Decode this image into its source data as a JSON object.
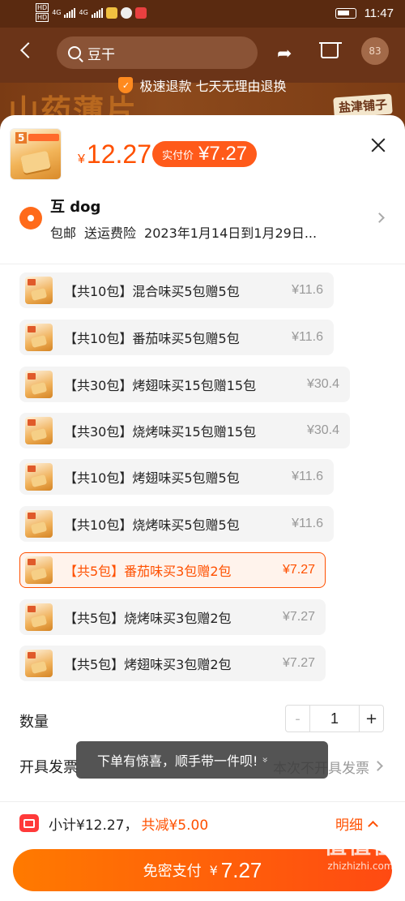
{
  "status_bar": {
    "network_1": "4G",
    "network_2": "4G",
    "hd_label": "HD",
    "time": "11:47"
  },
  "nav": {
    "search_text": "豆干",
    "cart_badge": "83"
  },
  "banner": {
    "refund_text": "极速退款 七天无理由退换",
    "bg_title": "山药薄片",
    "bg_brand": "盐津铺子"
  },
  "product": {
    "thumb_count": "5",
    "price_symbol": "¥",
    "price": "12.27",
    "real_price_label": "实付价",
    "real_price": "¥7.27"
  },
  "address": {
    "name": "互 dog",
    "shipping": "包邮",
    "insurance": "送运费险",
    "delivery": "2023年1月14日到1月29日..."
  },
  "options": [
    {
      "name": "【共10包】混合味买5包赠5包",
      "price": "¥11.6",
      "selected": false
    },
    {
      "name": "【共10包】番茄味买5包赠5包",
      "price": "¥11.6",
      "selected": false
    },
    {
      "name": "【共30包】烤翅味买15包赠15包",
      "price": "¥30.4",
      "selected": false
    },
    {
      "name": "【共30包】烧烤味买15包赠15包",
      "price": "¥30.4",
      "selected": false
    },
    {
      "name": "【共10包】烤翅味买5包赠5包",
      "price": "¥11.6",
      "selected": false
    },
    {
      "name": "【共10包】烧烤味买5包赠5包",
      "price": "¥11.6",
      "selected": false
    },
    {
      "name": "【共5包】番茄味买3包赠2包",
      "price": "¥7.27",
      "selected": true
    },
    {
      "name": "【共5包】烧烤味买3包赠2包",
      "price": "¥7.27",
      "selected": false
    },
    {
      "name": "【共5包】烤翅味买3包赠2包",
      "price": "¥7.27",
      "selected": false
    }
  ],
  "quantity": {
    "label": "数量",
    "minus": "-",
    "value": "1",
    "plus": "+"
  },
  "invoice": {
    "label": "开具发票",
    "value": "本次不开具发票"
  },
  "toast": {
    "text": "下单有惊喜，顺手带一件呗!",
    "chevron": "»"
  },
  "footer": {
    "subtotal": "小计¥12.27，",
    "discount": "共减¥5.00",
    "detail": "明细",
    "pay_label": "免密支付",
    "pay_symbol": "¥",
    "pay_amount": "7.27"
  },
  "watermark": {
    "big": "值值值",
    "url": "zhizhizhi.com"
  },
  "colors": {
    "accent": "#ff5000",
    "selected_bg": "#fff3ec",
    "pay_gradient_start": "#ff7a00",
    "pay_gradient_end": "#ff4a12"
  }
}
